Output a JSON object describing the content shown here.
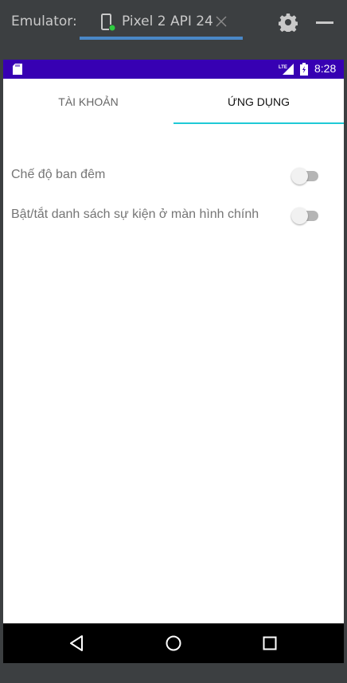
{
  "emulator": {
    "label": "Emulator:",
    "device_tab": "Pixel 2 API 24"
  },
  "status_bar": {
    "network": "LTE",
    "time": "8:28",
    "bg_color": "#3700b3"
  },
  "tabs": [
    {
      "label": "TÀI KHOẢN",
      "selected": false
    },
    {
      "label": "ỨNG DỤNG",
      "selected": true
    }
  ],
  "accent_color": "#1fc9d6",
  "settings": [
    {
      "label": "Chế độ ban đêm",
      "enabled": false
    },
    {
      "label": "Bật/tắt danh sách sự kiện ở màn hình chính",
      "enabled": false
    }
  ],
  "icons": [
    "phone-icon",
    "close-icon",
    "gear-icon",
    "minimize-icon",
    "sd-card-icon",
    "lte-signal-icon",
    "battery-icon",
    "back-icon",
    "home-icon",
    "recents-icon"
  ]
}
